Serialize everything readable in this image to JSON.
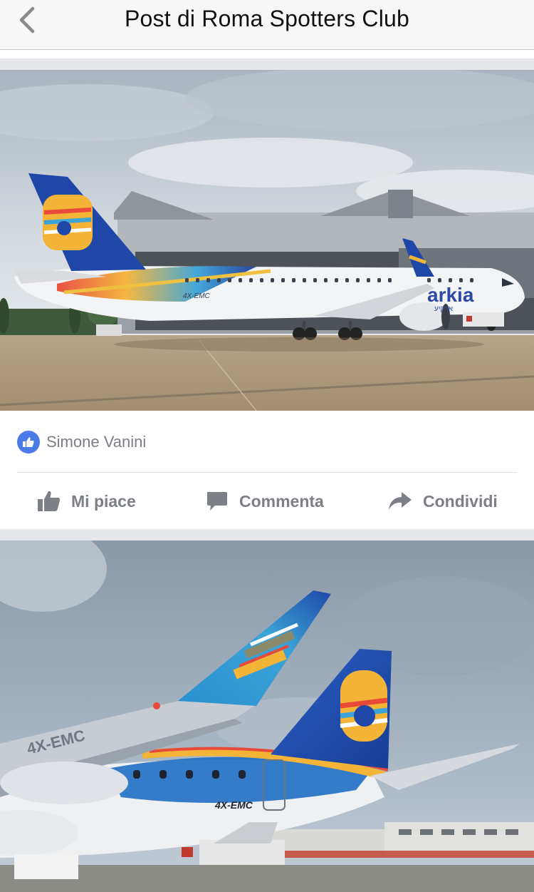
{
  "header": {
    "title": "Post di Roma Spotters Club",
    "back_icon": "chevron-left-icon"
  },
  "post": {
    "photos": [
      {
        "registration": "4X-EMC",
        "airline_text": "arkia",
        "airline_subtext": "ארקיע"
      },
      {
        "registration": "4X-EMC",
        "wing_text": "4X-EMC"
      }
    ],
    "likes": {
      "icon": "thumbs-up-icon",
      "name": "Simone Vanini"
    },
    "actions": {
      "like_label": "Mi piace",
      "comment_label": "Commenta",
      "share_label": "Condividi"
    }
  },
  "colors": {
    "accent": "#4a7be8",
    "muted_text": "#7c7f86",
    "separator": "#e6e7ea"
  }
}
